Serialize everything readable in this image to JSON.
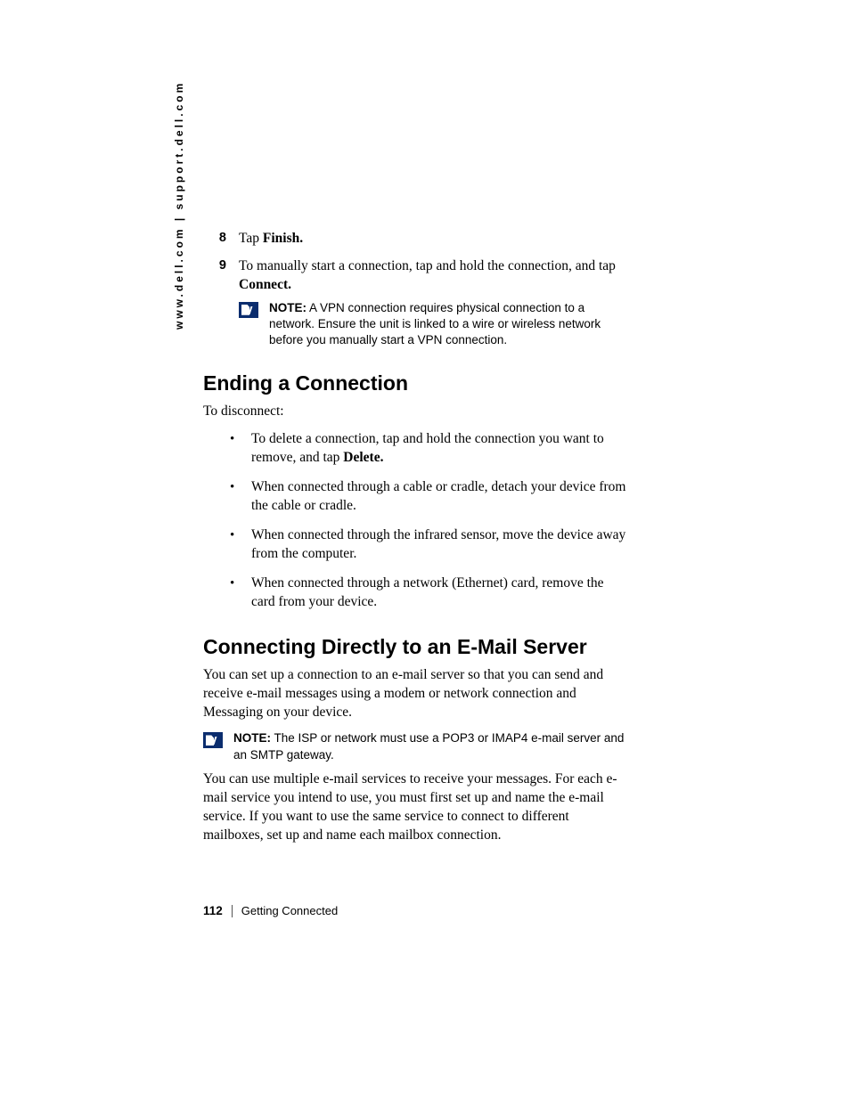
{
  "side_url": "www.dell.com | support.dell.com",
  "steps": {
    "eight": {
      "num": "8",
      "pre": "Tap ",
      "bold": "Finish."
    },
    "nine": {
      "num": "9",
      "pre": "To manually start a connection, tap and hold the connection, and tap ",
      "bold": "Connect."
    }
  },
  "notes": {
    "vpn": {
      "label": "NOTE:",
      "text": " A VPN connection requires physical connection to a network. Ensure the unit is linked to a wire or wireless network before you manually start a VPN connection."
    },
    "pop": {
      "label": "NOTE:",
      "text": " The ISP or network must use a POP3 or IMAP4 e-mail server and an SMTP gateway."
    }
  },
  "headings": {
    "ending": "Ending a Connection",
    "email": "Connecting Directly to an E-Mail Server"
  },
  "ending_intro": "To disconnect:",
  "ending_bullets": {
    "b1_pre": "To delete a connection, tap and hold the connection you want to remove, and tap ",
    "b1_bold": "Delete.",
    "b2": "When connected through a cable or cradle, detach your device from the cable or cradle.",
    "b3": "When connected through the infrared sensor, move the device away from the computer.",
    "b4": "When connected through a network (Ethernet) card, remove the card from your device."
  },
  "email_para1": "You can set up a connection to an e-mail server so that you can send and receive e-mail messages using a modem or network connection and Messaging on your device.",
  "email_para2": "You can use multiple e-mail services to receive your messages. For each e-mail service you intend to use, you must first set up and name the e-mail service. If you want to use the same service to connect to different mailboxes, set up and name each mailbox connection.",
  "footer": {
    "page": "112",
    "section": "Getting Connected"
  }
}
